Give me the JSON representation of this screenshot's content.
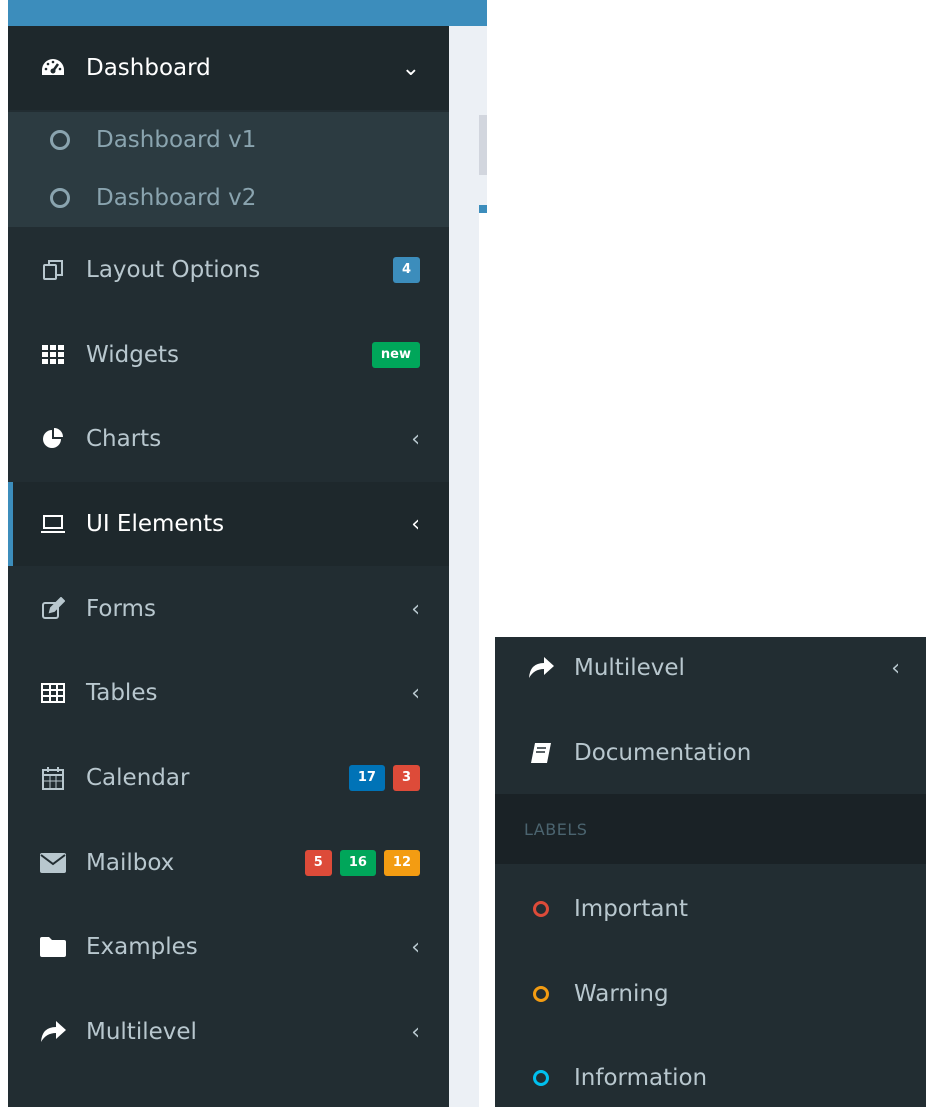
{
  "sidebar": {
    "items": [
      {
        "label": "Dashboard",
        "icon": "dashboard-icon",
        "indicator": "⌄"
      },
      {
        "label": "Layout Options",
        "icon": "files-icon",
        "badges": [
          {
            "text": "4",
            "color": "#3c8dbc"
          }
        ]
      },
      {
        "label": "Widgets",
        "icon": "th-icon",
        "badges": [
          {
            "text": "new",
            "color": "#00a65a"
          }
        ]
      },
      {
        "label": "Charts",
        "icon": "pie-chart-icon",
        "indicator": "‹"
      },
      {
        "label": "UI Elements",
        "icon": "laptop-icon",
        "indicator": "‹"
      },
      {
        "label": "Forms",
        "icon": "edit-icon",
        "indicator": "‹"
      },
      {
        "label": "Tables",
        "icon": "table-icon",
        "indicator": "‹"
      },
      {
        "label": "Calendar",
        "icon": "calendar-icon",
        "badges": [
          {
            "text": "17",
            "color": "#0073b7"
          },
          {
            "text": "3",
            "color": "#dd4b39"
          }
        ]
      },
      {
        "label": "Mailbox",
        "icon": "envelope-icon",
        "badges": [
          {
            "text": "5",
            "color": "#dd4b39"
          },
          {
            "text": "16",
            "color": "#00a65a"
          },
          {
            "text": "12",
            "color": "#f39c12"
          }
        ]
      },
      {
        "label": "Examples",
        "icon": "folder-icon",
        "indicator": "‹"
      },
      {
        "label": "Multilevel",
        "icon": "share-icon",
        "indicator": "‹"
      }
    ],
    "dashboard_submenu": [
      {
        "label": "Dashboard v1"
      },
      {
        "label": "Dashboard v2"
      }
    ]
  },
  "second_panel": {
    "items": [
      {
        "label": "Multilevel",
        "icon": "share-icon",
        "indicator": "‹"
      },
      {
        "label": "Documentation",
        "icon": "book-icon"
      }
    ],
    "labels_header": "LABELS",
    "labels": [
      {
        "label": "Important",
        "color": "#dd4b39"
      },
      {
        "label": "Warning",
        "color": "#f39c12"
      },
      {
        "label": "Information",
        "color": "#00c0ef"
      }
    ]
  }
}
